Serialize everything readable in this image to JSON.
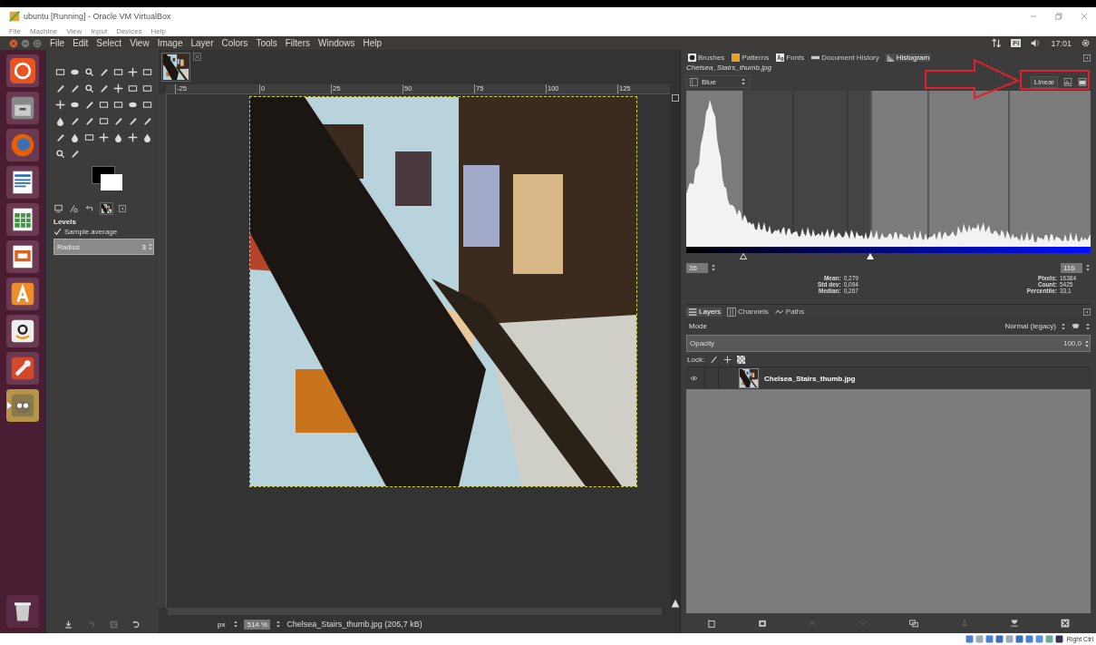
{
  "vbox": {
    "title": "ubuntu [Running] - Oracle VM VirtualBox",
    "menu": [
      "File",
      "Machine",
      "View",
      "Input",
      "Devices",
      "Help"
    ],
    "host_key": "Right Ctrl"
  },
  "topbar": {
    "menu": [
      "File",
      "Edit",
      "Select",
      "View",
      "Image",
      "Layer",
      "Colors",
      "Tools",
      "Filters",
      "Windows",
      "Help"
    ],
    "keyboard": "Fi",
    "clock": "17:01"
  },
  "launcher": [
    {
      "kind": "dash",
      "active": false
    },
    {
      "kind": "files",
      "active": false
    },
    {
      "kind": "browser",
      "active": false
    },
    {
      "kind": "writer",
      "active": false
    },
    {
      "kind": "calc",
      "active": false
    },
    {
      "kind": "impress",
      "active": false
    },
    {
      "kind": "store",
      "active": false
    },
    {
      "kind": "shop",
      "active": false
    },
    {
      "kind": "settings",
      "active": false
    },
    {
      "kind": "gimp",
      "active": true
    }
  ],
  "toolbox": {
    "options_title": "Levels",
    "sample_average": {
      "label": "Sample average",
      "checked": true
    },
    "radius": {
      "label": "Radius",
      "value": "3"
    }
  },
  "canvas": {
    "ruler_labels": [
      "-25",
      "0",
      "25",
      "50",
      "75",
      "100",
      "125"
    ],
    "unit": "px",
    "zoom": "514 %",
    "status": "Chelsea_Stairs_thumb.jpg (205,7 kB)"
  },
  "dock_tabs": [
    {
      "label": "Brushes",
      "selected": false
    },
    {
      "label": "Patterns",
      "selected": false
    },
    {
      "label": "Fonts",
      "selected": false
    },
    {
      "label": "Document History",
      "selected": false
    },
    {
      "label": "Histogram",
      "selected": true
    }
  ],
  "histogram": {
    "image": "Chelsea_Stairs_thumb.jpg",
    "channel": "Blue",
    "scale": "Linear",
    "range_start": "36",
    "range_end": "116",
    "stats_left": [
      {
        "label": "Mean:",
        "value": "0,279"
      },
      {
        "label": "Std dev:",
        "value": "0,094"
      },
      {
        "label": "Median:",
        "value": "0,267"
      }
    ],
    "stats_right": [
      {
        "label": "Pixels:",
        "value": "16384"
      },
      {
        "label": "Count:",
        "value": "5425"
      },
      {
        "label": "Percentile:",
        "value": "33,1"
      }
    ]
  },
  "layer_tabs": [
    {
      "label": "Layers",
      "selected": true
    },
    {
      "label": "Channels",
      "selected": false
    },
    {
      "label": "Paths",
      "selected": false
    }
  ],
  "layers": {
    "mode_label": "Mode",
    "mode": "Normal (legacy)",
    "opacity_label": "Opacity",
    "opacity": "100,0",
    "lock_label": "Lock:",
    "items": [
      {
        "name": "Chelsea_Stairs_thumb.jpg",
        "visible": true
      }
    ]
  }
}
